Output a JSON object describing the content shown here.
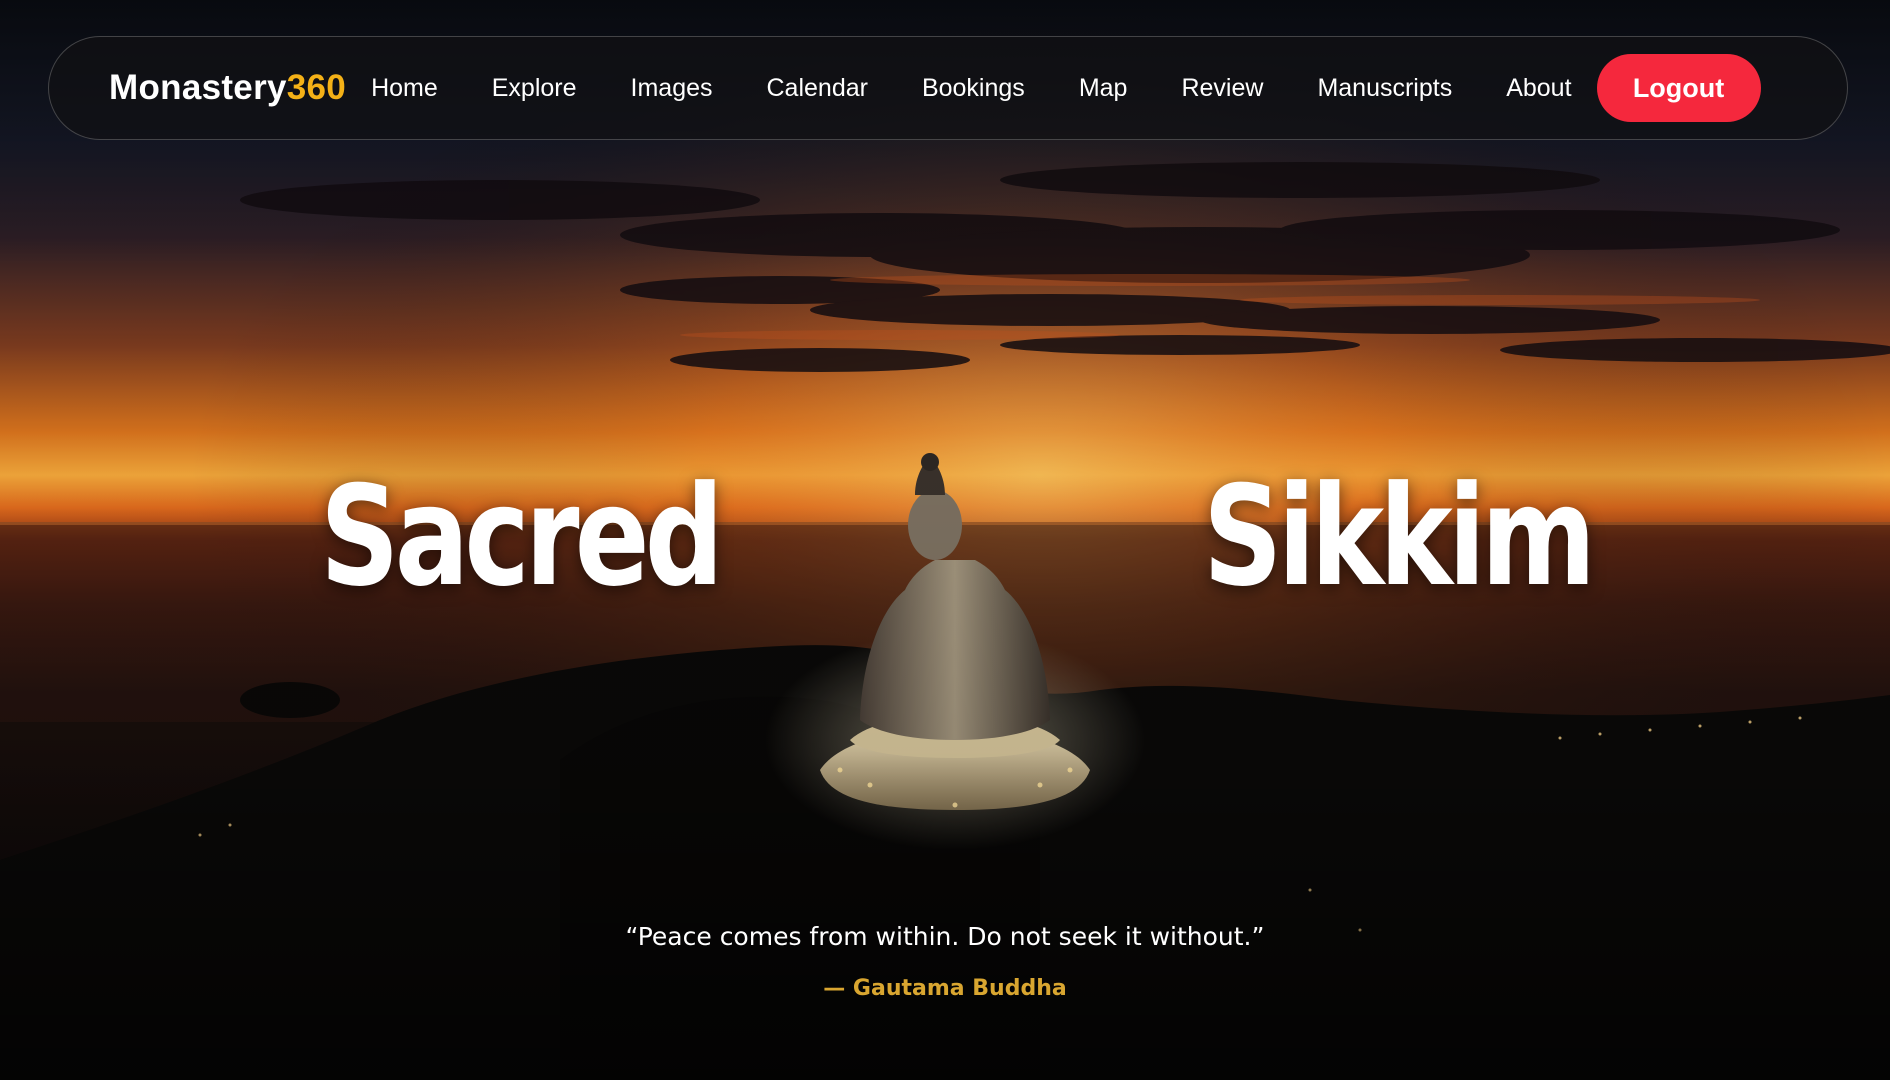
{
  "colors": {
    "brand_accent": "#f4b117",
    "logout_bg": "#f5283d",
    "author_gold": "#d9a630",
    "sky_glow": "#f58a24"
  },
  "navbar": {
    "brand_name": "Monastery",
    "brand_suffix": "360",
    "links": [
      {
        "label": "Home"
      },
      {
        "label": "Explore"
      },
      {
        "label": "Images"
      },
      {
        "label": "Calendar"
      },
      {
        "label": "Bookings"
      },
      {
        "label": "Map"
      },
      {
        "label": "Review"
      },
      {
        "label": "Manuscripts"
      },
      {
        "label": "About"
      }
    ],
    "logout_label": "Logout"
  },
  "hero": {
    "word_left": "Sacred",
    "word_right": "Sikkim",
    "quote": "“Peace comes from within. Do not seek it without.”",
    "author": "— Gautama Buddha"
  }
}
